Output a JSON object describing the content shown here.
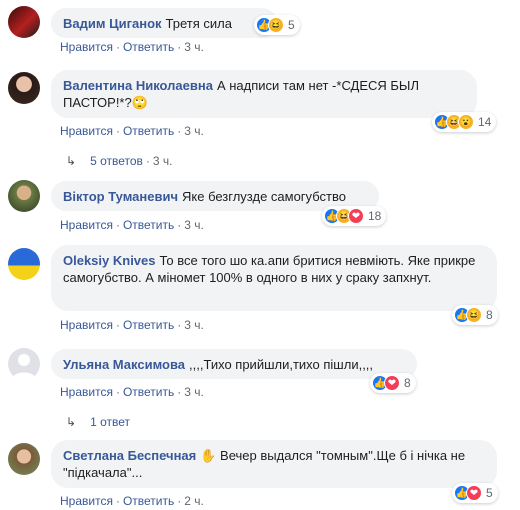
{
  "actions": {
    "like": "Нравится",
    "reply": "Ответить",
    "dot": "·"
  },
  "comments": [
    {
      "author": "Вадим Циганок",
      "text": "Третя сила",
      "time": "3 ч.",
      "reactions": [
        "like",
        "haha"
      ],
      "count": "5"
    },
    {
      "author": "Валентина Николаевна",
      "text": "А надписи там нет -*СДЕСЯ БЫЛ ПАСТОР!*?🙄",
      "time": "3 ч.",
      "reactions": [
        "like",
        "haha",
        "wow"
      ],
      "count": "14"
    },
    {
      "author": "Віктор Туманевич",
      "text": "Яке безглузде самогубство",
      "time": "3 ч.",
      "reactions": [
        "like",
        "haha",
        "love"
      ],
      "count": "18"
    },
    {
      "author": "Oleksiy Knives",
      "text": "То все того шо ка.апи бритися невміють. Яке прикре самогубство. А міномет 100% в одного в них у сраку запхнут.",
      "time": "3 ч.",
      "reactions": [
        "like",
        "haha"
      ],
      "count": "8"
    },
    {
      "author": "Ульяна Максимова",
      "text": ",,,,Тихо прийшли,тихо пішли,,,,",
      "time": "3 ч.",
      "reactions": [
        "like",
        "love"
      ],
      "count": "8"
    },
    {
      "author": "Светлана Беспечная",
      "text": "✋ Вечер выдался \"томным\".Ще б і нічка не \"підкачала\"...",
      "time": "2 ч.",
      "reactions": [
        "like",
        "love"
      ],
      "count": "5"
    }
  ],
  "replies": [
    {
      "label": "5 ответов",
      "time": "3 ч."
    },
    {
      "label": "1 ответ"
    }
  ]
}
